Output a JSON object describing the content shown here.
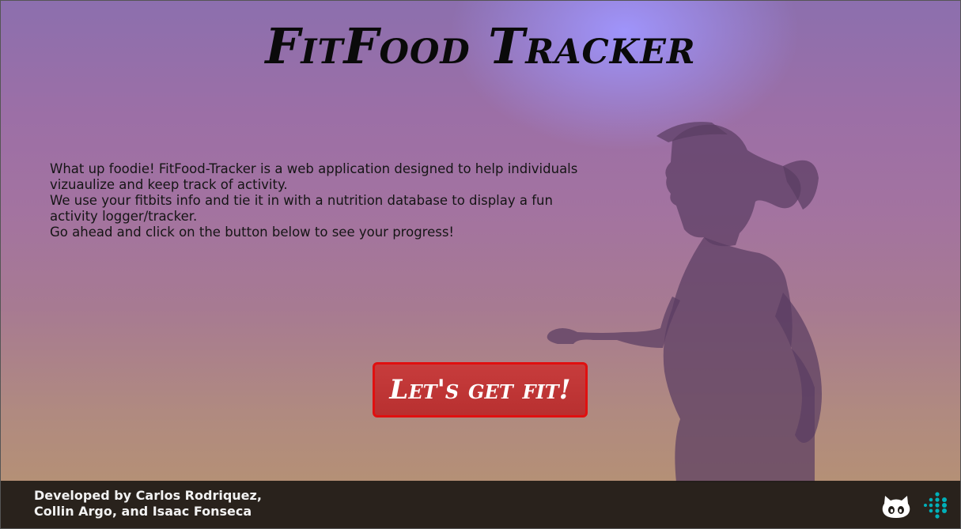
{
  "app": {
    "title": "FitFood Tracker"
  },
  "intro": {
    "line1": "What up foodie! FitFood-Tracker is a web application designed to help individuals vizuaulize and keep track of activity.",
    "line2": "We use your fitbits info and tie it in with a nutrition database to display a fun activity logger/tracker.",
    "line3": "Go ahead and click on the button below to see your progress!"
  },
  "cta": {
    "label": "Let's get fit!"
  },
  "footer": {
    "credits_line1": "Developed by Carlos Rodriquez,",
    "credits_line2": "Collin Argo, and Isaac Fonseca",
    "icons": [
      "github-icon",
      "fitbit-icon"
    ]
  },
  "colors": {
    "button_bg": "#c33636",
    "button_border": "#e01010",
    "footer_bg": "#1e1a16",
    "fitbit_teal": "#00b0b9"
  }
}
